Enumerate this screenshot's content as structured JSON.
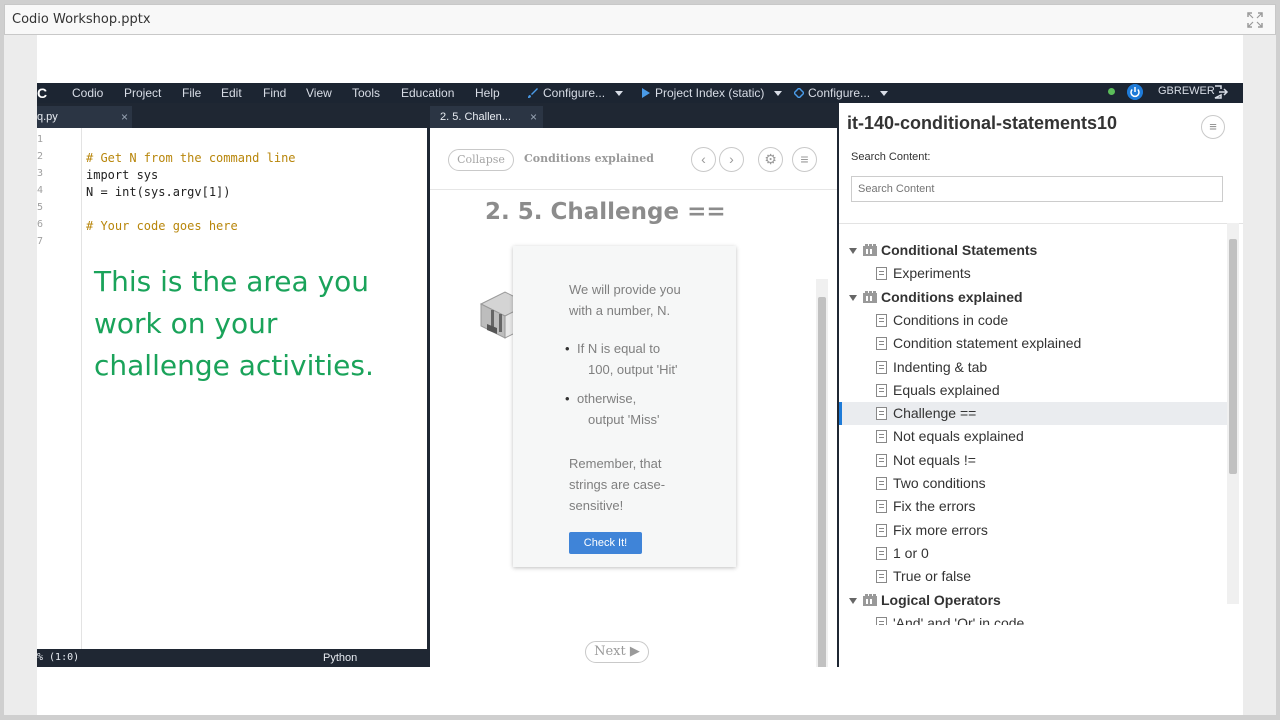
{
  "viewer": {
    "title": "Codio Workshop.pptx"
  },
  "menubar": {
    "items": [
      "Codio",
      "Project",
      "File",
      "Edit",
      "Find",
      "View",
      "Tools",
      "Education",
      "Help"
    ],
    "configure1": "Configure...",
    "project_index": "Project Index (static)",
    "configure2": "Configure...",
    "username": "GBREWER"
  },
  "editor": {
    "tab_label": "q.py",
    "tab_close": "×",
    "line_numbers": [
      "1",
      "2",
      "3",
      "4",
      "5",
      "6",
      "7"
    ],
    "code": [
      "",
      "# Get N from the command line",
      "import sys",
      "N = int(sys.argv[1])",
      "",
      "# Your code goes here",
      ""
    ],
    "annotation": "This is the area you work on your challenge activities.",
    "status_position": "% (1:0)",
    "status_language": "Python"
  },
  "guide": {
    "tab_label": "2. 5. Challen...",
    "tab_close": "×",
    "collapse_label": "Collapse",
    "section_title": "Conditions explained",
    "heading": "2. 5. Challenge ==",
    "card": {
      "intro_line1": "We will provide you",
      "intro_line2": "with a number, N.",
      "bullet1_line1": "If N is equal to",
      "bullet1_line2": "100, output 'Hit'",
      "bullet2_line1": "otherwise,",
      "bullet2_line2": "output 'Miss'",
      "note_line1": "Remember, that",
      "note_line2": "strings are case-",
      "note_line3": "sensitive!",
      "check_label": "Check It!"
    },
    "next_label": "Next"
  },
  "tree": {
    "project_name": "it-140-conditional-statements10",
    "search_label": "Search Content:",
    "search_placeholder": "Search Content",
    "rows": [
      {
        "type": "folder",
        "label": "Conditional Statements"
      },
      {
        "type": "page",
        "label": "Experiments"
      },
      {
        "type": "folder",
        "label": "Conditions explained"
      },
      {
        "type": "page",
        "label": "Conditions in code"
      },
      {
        "type": "page",
        "label": "Condition statement explained"
      },
      {
        "type": "page",
        "label": "Indenting & tab"
      },
      {
        "type": "page",
        "label": "Equals explained"
      },
      {
        "type": "page",
        "label": "Challenge ==",
        "selected": true
      },
      {
        "type": "page",
        "label": "Not equals explained"
      },
      {
        "type": "page",
        "label": "Not equals !="
      },
      {
        "type": "page",
        "label": "Two conditions"
      },
      {
        "type": "page",
        "label": "Fix the errors"
      },
      {
        "type": "page",
        "label": "Fix more errors"
      },
      {
        "type": "page",
        "label": "1 or 0"
      },
      {
        "type": "page",
        "label": "True or false"
      },
      {
        "type": "folder",
        "label": "Logical Operators"
      },
      {
        "type": "page",
        "label": "'And' and 'Or' in code"
      }
    ]
  },
  "colors": {
    "menubar_bg": "#1c2532",
    "annotation": "#1aa35a",
    "accent": "#1e7bd8",
    "check_button": "#3f84d8"
  }
}
